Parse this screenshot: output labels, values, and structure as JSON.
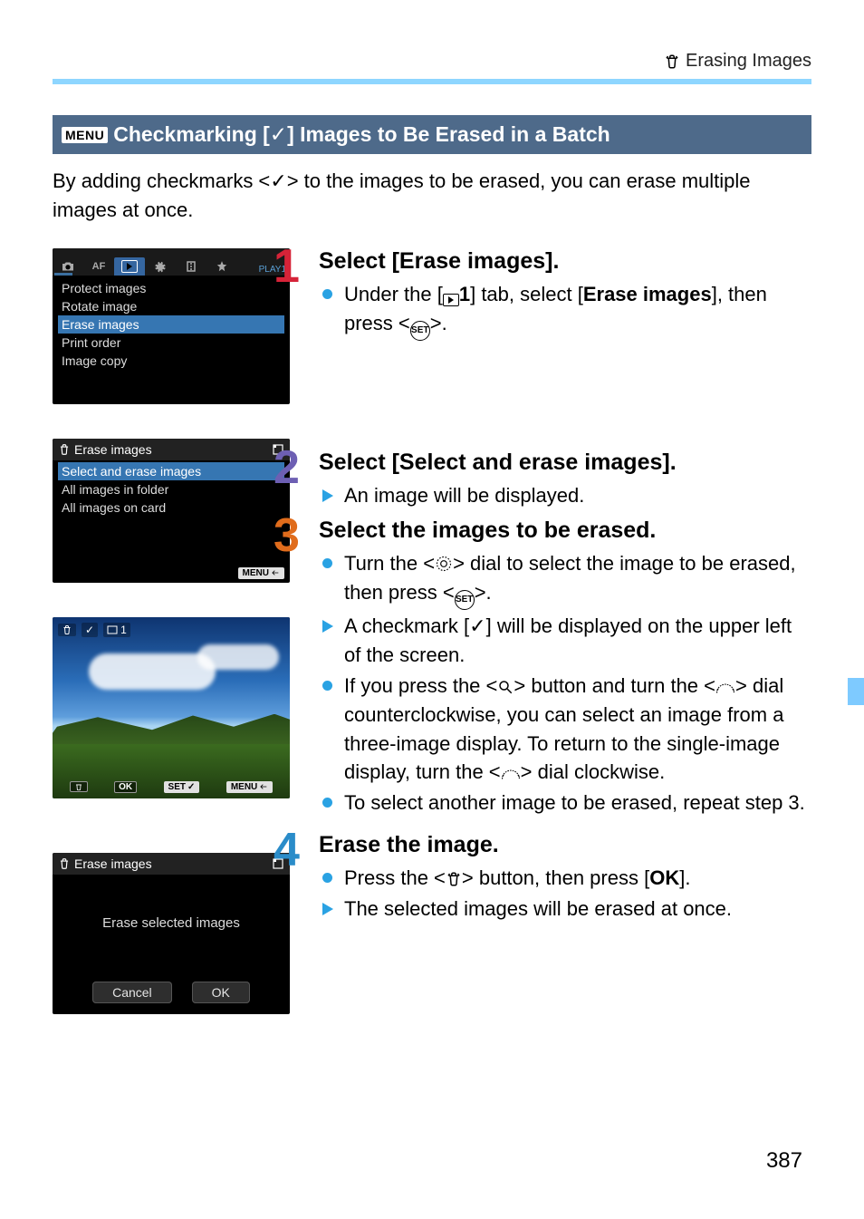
{
  "header": {
    "title": "Erasing Images"
  },
  "section_heading": {
    "menu_label": "MENU",
    "prefix": "Checkmarking [",
    "check": "✓",
    "suffix": "] Images to Be Erased in a Batch"
  },
  "intro": {
    "t1": "By adding checkmarks <",
    "check": "✓",
    "t2": "> to the images to be erased, you can erase multiple images at once."
  },
  "screens": {
    "menu1": {
      "play_label": "PLAY1",
      "items": [
        "Protect images",
        "Rotate image",
        "Erase images",
        "Print order",
        "Image copy"
      ],
      "selected_index": 2,
      "af_label": "AF"
    },
    "menu2": {
      "title": "Erase images",
      "items": [
        "Select and erase images",
        "All images in folder",
        "All images on card"
      ],
      "selected_index": 0,
      "menu_back": "MENU"
    },
    "photo": {
      "counter": "1",
      "ok_label": "OK",
      "set_label": "SET",
      "menu_label": "MENU"
    },
    "dialog": {
      "title": "Erase images",
      "msg": "Erase selected images",
      "cancel": "Cancel",
      "ok": "OK"
    }
  },
  "steps": {
    "s1": {
      "title": "Select [Erase images].",
      "b1a": "Under the [",
      "b1tab": "1",
      "b1b": "] tab, select [",
      "b1bold": "Erase images",
      "b1c": "], then press <",
      "b1d": ">."
    },
    "s2": {
      "title": "Select [Select and erase images].",
      "b1": "An image will be displayed."
    },
    "s3": {
      "title": "Select the images to be erased.",
      "b1a": "Turn the <",
      "b1b": "> dial to select the image to be erased, then press <",
      "b1c": ">.",
      "b2a": "A checkmark [",
      "b2chk": "✓",
      "b2b": "] will be displayed on the upper left of the screen.",
      "b3a": "If you press the <",
      "b3b": "> button and turn the <",
      "b3c": "> dial counterclockwise, you can select an image from a three-image display. To return to the single-image display, turn the <",
      "b3d": "> dial clockwise.",
      "b4": "To select another image to be erased, repeat step 3."
    },
    "s4": {
      "title": "Erase the image.",
      "b1a": "Press the <",
      "b1b": "> button, then press [",
      "b1ok": "OK",
      "b1c": "].",
      "b2": "The selected images will be erased at once."
    }
  },
  "page_number": "387"
}
